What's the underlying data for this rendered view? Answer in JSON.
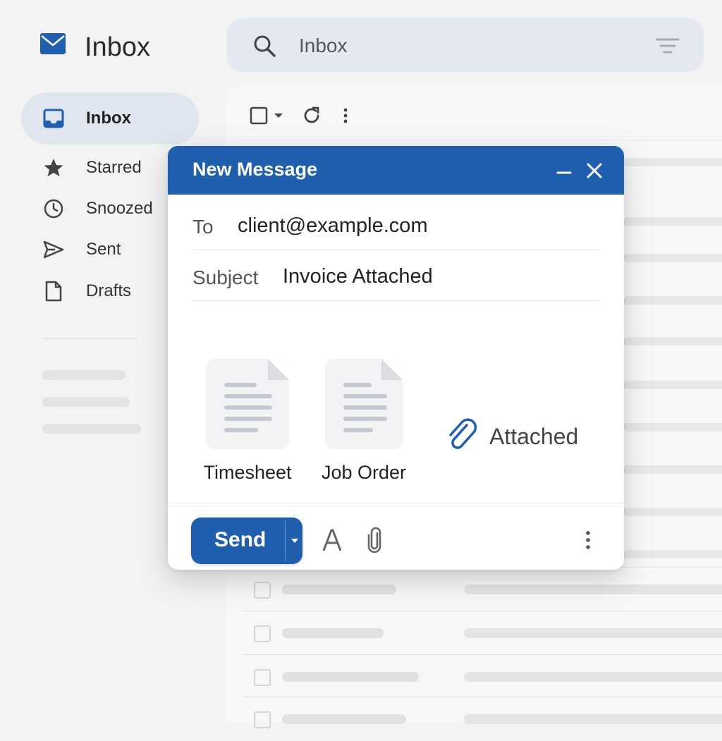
{
  "app": {
    "title": "Inbox",
    "brand_color": "#1f5fae"
  },
  "sidebar": {
    "items": [
      {
        "label": "Inbox",
        "icon": "inbox-icon",
        "active": true
      },
      {
        "label": "Starred",
        "icon": "star-icon"
      },
      {
        "label": "Snoozed",
        "icon": "clock-icon"
      },
      {
        "label": "Sent",
        "icon": "send-icon"
      },
      {
        "label": "Drafts",
        "icon": "draft-icon"
      }
    ]
  },
  "search": {
    "value": "Inbox",
    "icons": [
      "search-icon",
      "filter-icon"
    ]
  },
  "list_toolbar": {
    "icons": [
      "select-checkbox-icon",
      "chevron-down-icon",
      "refresh-icon",
      "more-vert-icon"
    ]
  },
  "compose": {
    "title": "New Message",
    "header_icons": [
      "minimize-icon",
      "close-icon"
    ],
    "to_label": "To",
    "to_value": "client@example.com",
    "subject_label": "Subject",
    "subject_value": "Invoice Attached",
    "attachments": [
      {
        "name": "Timesheet",
        "icon": "document-icon"
      },
      {
        "name": "Job Order",
        "icon": "document-icon"
      }
    ],
    "attached_label": "Attached",
    "attached_icon": "paperclip-icon",
    "send_label": "Send",
    "footer_icons": [
      "send-options-icon",
      "text-format-icon",
      "attach-icon",
      "more-vert-icon"
    ]
  }
}
